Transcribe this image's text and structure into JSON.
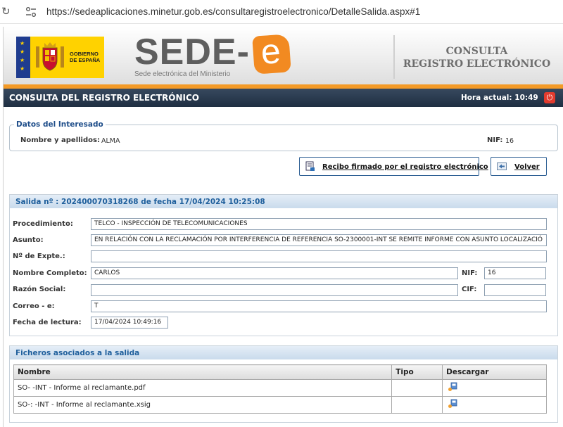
{
  "browser": {
    "url": "https://sedeaplicaciones.minetur.gob.es/consultaregistroelectronico/DetalleSalida.aspx#1"
  },
  "header": {
    "gov_logo_line1": "GOBIERNO",
    "gov_logo_line2": "DE ESPAÑA",
    "brand": "SEDE-",
    "brand_e": "e",
    "brand_sub": "Sede electrónica del Ministerio",
    "consulta_line1": "CONSULTA",
    "consulta_line2": "REGISTRO ELECTRÓNICO",
    "accent_color": "#f39a27"
  },
  "titlebar": {
    "title": "CONSULTA DEL REGISTRO ELECTRÓNICO",
    "hora_label": "Hora actual:",
    "hora_value": "10:49"
  },
  "interesado": {
    "legend": "Datos del Interesado",
    "nombre_label": "Nombre y apellidos:",
    "nombre_value": "ALMA",
    "nif_label": "NIF:",
    "nif_value": "16"
  },
  "actions": {
    "recibo_label": "Recibo firmado por el registro electrónico",
    "volver_label": "Volver"
  },
  "salida": {
    "header": "Salida nº : 202400070318268 de fecha 17/04/2024 10:25:08",
    "procedimiento_label": "Procedimiento:",
    "procedimiento_value": "TELCO - INSPECCIÓN DE TELECOMUNICACIONES",
    "asunto_label": "Asunto:",
    "asunto_value": "EN RELACIÓN CON LA RECLAMACIÓN POR INTERFERENCIA DE REFERENCIA SO-2300001-INT SE REMITE INFORME CON ASUNTO LOCALIZACIÓ",
    "expte_label": "Nº de Expte.:",
    "expte_value": "",
    "nombre_label": "Nombre Completo:",
    "nombre_value": "CARLOS",
    "nif_label": "NIF:",
    "nif_value": "16",
    "razon_label": "Razón Social:",
    "razon_value": "",
    "cif_label": "CIF:",
    "cif_value": "",
    "correo_label": "Correo - e:",
    "correo_value": "T",
    "fecha_label": "Fecha de lectura:",
    "fecha_value": "17/04/2024 10:49:16"
  },
  "ficheros": {
    "header": "Ficheros asociados a la salida",
    "columns": [
      "Nombre",
      "Tipo",
      "Descargar"
    ],
    "rows": [
      {
        "nombre": "SO-          -INT - Informe al reclamante.pdf",
        "tipo": ""
      },
      {
        "nombre": "SO-:         -INT - Informe al reclamante.xsig",
        "tipo": ""
      }
    ]
  }
}
